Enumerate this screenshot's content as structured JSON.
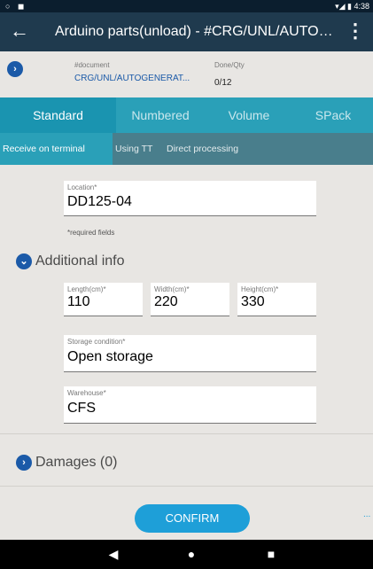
{
  "status_bar": {
    "left_icons": "○ ◼",
    "right": "▾◢ ▮ 4:38"
  },
  "app_bar": {
    "back_glyph": "←",
    "title": "Arduino parts(unload) - #CRG/UNL/AUTOGENERATED",
    "more_glyph": "⋮"
  },
  "document": {
    "expand_glyph": "›",
    "doc_label": "#document",
    "doc_value": "CRG/UNL/AUTOGENERAT...",
    "done_label": "Done/Qty",
    "done_value": "0/12"
  },
  "tabs": [
    "Standard",
    "Numbered",
    "Volume",
    "SPack"
  ],
  "subtabs": [
    "Receive on terminal",
    "Using TT",
    "Direct processing"
  ],
  "location": {
    "label": "Location*",
    "value": "DD125-04"
  },
  "required_note": "*required fields",
  "additional": {
    "glyph": "⌄",
    "title": "Additional info",
    "length": {
      "label": "Length(cm)*",
      "value": "110"
    },
    "width": {
      "label": "Width(cm)*",
      "value": "220"
    },
    "height": {
      "label": "Height(cm)*",
      "value": "330"
    },
    "storage": {
      "label": "Storage condition*",
      "value": "Open storage"
    },
    "warehouse": {
      "label": "Warehouse*",
      "value": "CFS"
    }
  },
  "damages": {
    "glyph": "›",
    "title": "Damages (0)"
  },
  "confirm_label": "CONFIRM",
  "more_dots": "...",
  "nav": {
    "back": "◀",
    "home": "●",
    "recents": "■"
  },
  "colors": {
    "primary": "#1f3a4e",
    "tab_bar": "#2aa0b8",
    "subtab_bar": "#497e8c",
    "accent": "#1e9fd8",
    "icon_blue": "#1b5aa8"
  }
}
